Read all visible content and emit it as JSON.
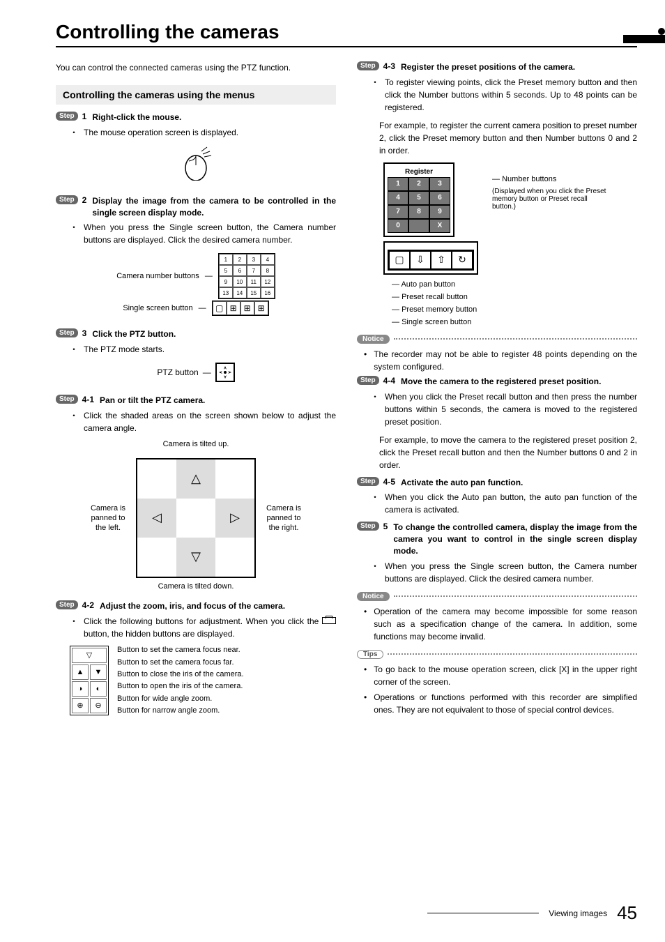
{
  "title": "Controlling the cameras",
  "intro": "You can control the connected cameras using the PTZ function.",
  "subhead": "Controlling the cameras using the menus",
  "steps": {
    "s1": {
      "badge": "Step",
      "num": "1",
      "title": "Right-click the mouse.",
      "b1": "The mouse operation screen is displayed."
    },
    "s2": {
      "badge": "Step",
      "num": "2",
      "title": "Display the image from the camera to be controlled in the single screen display mode.",
      "b1": "When you press the Single screen button, the Camera number buttons are displayed. Click the desired camera number."
    },
    "s2labels": {
      "camnum": "Camera number buttons",
      "single": "Single screen button"
    },
    "s3": {
      "badge": "Step",
      "num": "3",
      "title": "Click the PTZ button.",
      "b1": "The PTZ mode starts.",
      "ptz": "PTZ button"
    },
    "s41": {
      "badge": "Step",
      "num": "4-1",
      "title": "Pan or tilt the PTZ camera.",
      "b1": "Click the shaded areas on the screen shown below to adjust the camera angle."
    },
    "tilt": {
      "up": "Camera is tilted up.",
      "down": "Camera is tilted down.",
      "left": "Camera is panned to the left.",
      "right": "Camera is panned to the right."
    },
    "s42": {
      "badge": "Step",
      "num": "4-2",
      "title": "Adjust the zoom, iris, and focus of the camera.",
      "b1": "Click the following buttons for adjustment. When you click the       button, the hidden buttons are displayed."
    },
    "zoomlabels": {
      "l1": "Button to set the camera focus near.",
      "l2": "Button to set the camera focus far.",
      "l3": "Button to close the iris of the camera.",
      "l4": "Button to open the iris of the camera.",
      "l5": "Button for wide angle zoom.",
      "l6": "Button for narrow angle zoom."
    },
    "s43": {
      "badge": "Step",
      "num": "4-3",
      "title": "Register the preset positions of the camera.",
      "b1": "To register viewing points, click the Preset memory button and then click the Number buttons within 5 seconds. Up to 48 points can be registered.",
      "p1": "For example, to register the current camera position to preset number 2, click the Preset memory button and then Number buttons 0 and 2 in order."
    },
    "reg": {
      "title": "Register",
      "btns": [
        "1",
        "2",
        "3",
        "4",
        "5",
        "6",
        "7",
        "8",
        "9",
        "0",
        "",
        "X"
      ],
      "lbl_num": "Number buttons",
      "lbl_num2": "(Displayed when you click the Preset memory button or Preset recall button.)",
      "lbl_auto": "Auto pan button",
      "lbl_recall": "Preset recall button",
      "lbl_memory": "Preset memory button",
      "lbl_single": "Single screen button"
    },
    "notice1": "The recorder may not be able to register 48 points depending on the system configured.",
    "s44": {
      "badge": "Step",
      "num": "4-4",
      "title": "Move the camera to the registered preset position.",
      "b1": "When you click the Preset recall button and then press the number buttons within 5 seconds, the camera is moved to the registered preset position.",
      "p1": "For example, to move the camera to the registered preset position 2, click the Preset recall button and then the Number buttons 0 and 2 in order."
    },
    "s45": {
      "badge": "Step",
      "num": "4-5",
      "title": "Activate the auto pan function.",
      "b1": "When you click the Auto pan button, the auto pan function of the camera is activated."
    },
    "s5": {
      "badge": "Step",
      "num": "5",
      "title": "To change the controlled camera, display the image from the camera you want to control in the single screen display mode.",
      "b1": "When you press the Single screen button, the Camera number buttons are displayed. Click the desired camera number."
    },
    "notice2": "Operation of the camera may become impossible for some reason such as a specification change of the camera. In addition, some functions may become invalid.",
    "tips1": "To go back to the mouse operation screen, click [X] in the upper right corner of the screen.",
    "tips2": "Operations or functions performed with this recorder are simplified ones. They are not equivalent to those of special control devices."
  },
  "labels": {
    "notice": "Notice",
    "tips": "Tips"
  },
  "footer": {
    "section": "Viewing images",
    "page": "45"
  },
  "grid16": [
    "1",
    "2",
    "3",
    "4",
    "5",
    "6",
    "7",
    "8",
    "9",
    "10",
    "11",
    "12",
    "13",
    "14",
    "15",
    "16"
  ]
}
